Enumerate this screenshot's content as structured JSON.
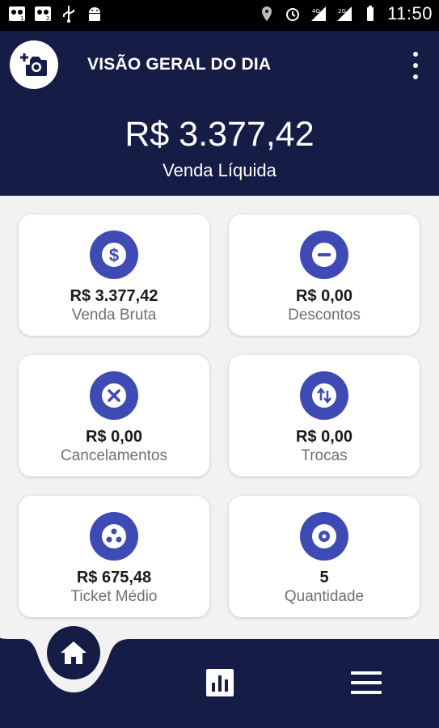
{
  "status_bar": {
    "time": "11:50",
    "icons": [
      "voicemail-1-icon",
      "voicemail-2-icon",
      "usb-icon",
      "android-debug-icon",
      "location-icon",
      "alarm-icon",
      "signal-4g-icon",
      "signal-2g-icon",
      "battery-icon"
    ]
  },
  "header": {
    "title": "VISÃO GERAL DO DIA",
    "camera_icon": "add-photo-icon",
    "menu_icon": "more-vertical-icon",
    "net_sales_value": "R$ 3.377,42",
    "net_sales_label": "Venda Líquida"
  },
  "cards": [
    {
      "value": "R$ 3.377,42",
      "label": "Venda Bruta",
      "icon": "dollar-icon"
    },
    {
      "value": "R$ 0,00",
      "label": "Descontos",
      "icon": "minus-icon"
    },
    {
      "value": "R$ 0,00",
      "label": "Cancelamentos",
      "icon": "cancel-icon"
    },
    {
      "value": "R$ 0,00",
      "label": "Trocas",
      "icon": "swap-icon"
    },
    {
      "value": "R$ 675,48",
      "label": "Ticket Médio",
      "icon": "ticket-icon"
    },
    {
      "value": "5",
      "label": "Quantidade",
      "icon": "quantity-icon"
    }
  ],
  "bottom_nav": {
    "items": [
      "home-icon",
      "bar-chart-icon",
      "hamburger-menu-icon"
    ]
  },
  "colors": {
    "primary": "#151c45",
    "accent": "#3f4bb4",
    "background": "#f2f2f2"
  }
}
